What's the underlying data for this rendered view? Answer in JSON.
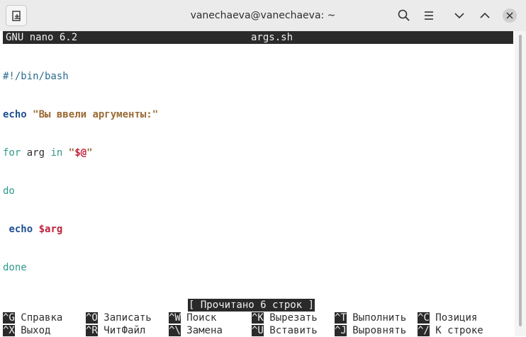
{
  "window": {
    "title": "vanechaeva@vanechaeva: ~"
  },
  "nano": {
    "version": "GNU nano 6.2",
    "filename": "args.sh"
  },
  "code": {
    "shebang": "#!/bin/bash",
    "echo_kw": "echo",
    "echo_str": "\"Вы ввели аргументы:\"",
    "for_kw": "for",
    "arg": "arg",
    "in_kw": "in",
    "in_q1": "\"",
    "in_var": "$@",
    "in_q2": "\"",
    "do_kw": "do",
    "echo2_kw": "echo",
    "echo2_var": "$arg",
    "done_kw": "done"
  },
  "status": "[ Прочитано 6 строк ]",
  "shortcuts": {
    "row1": [
      {
        "key": "^G",
        "label": "Справка"
      },
      {
        "key": "^O",
        "label": "Записать"
      },
      {
        "key": "^W",
        "label": "Поиск"
      },
      {
        "key": "^K",
        "label": "Вырезать"
      },
      {
        "key": "^T",
        "label": "Выполнить"
      },
      {
        "key": "^C",
        "label": "Позиция"
      }
    ],
    "row2": [
      {
        "key": "^X",
        "label": "Выход"
      },
      {
        "key": "^R",
        "label": "ЧитФайл"
      },
      {
        "key": "^\\",
        "label": "Замена"
      },
      {
        "key": "^U",
        "label": "Вставить"
      },
      {
        "key": "^J",
        "label": "Выровнять"
      },
      {
        "key": "^/",
        "label": "К строке"
      }
    ]
  },
  "icons": {
    "new_tab": "new-tab-icon",
    "search": "search-icon",
    "menu": "hamburger-menu-icon",
    "minimize": "chevron-down-icon",
    "maximize": "chevron-up-icon",
    "close": "close-icon"
  },
  "colors": {
    "titlebar": "#ebebeb",
    "nano_bar": "#2a2a2a",
    "keyword_blue": "#1e4f8f",
    "string": "#9a6b35",
    "keyword_teal": "#2f9a8c",
    "variable": "#c0213a"
  }
}
